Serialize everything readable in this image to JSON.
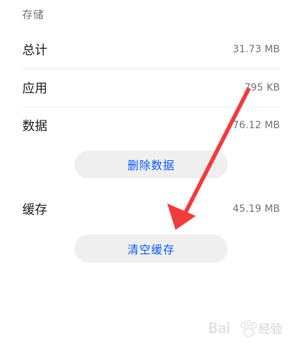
{
  "storage": {
    "section_title": "存储",
    "rows": [
      {
        "label": "总计",
        "value": "31.73 MB"
      },
      {
        "label": "应用",
        "value": "795 KB"
      },
      {
        "label": "数据",
        "value": "76.12 MB"
      }
    ],
    "delete_data_button": "删除数据"
  },
  "cache": {
    "label": "缓存",
    "value": "45.19 MB",
    "clear_cache_button": "清空缓存"
  },
  "annotation": {
    "arrow_color": "#f03c3c"
  },
  "theme": {
    "accent": "#0a59f7",
    "button_bg": "#efefef"
  },
  "watermark": {
    "text": "Bai 经验",
    "icon": "baidu-paw-icon"
  }
}
